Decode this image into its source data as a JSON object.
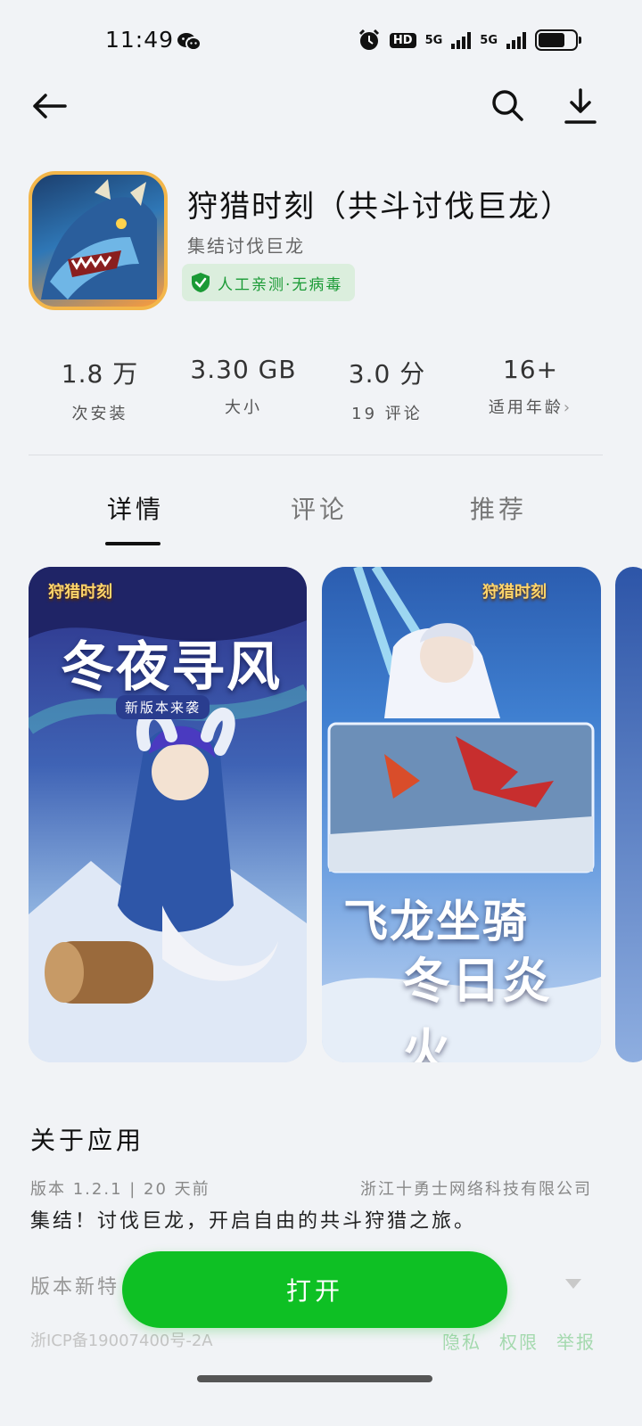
{
  "status": {
    "time": "11:49",
    "hd": "HD",
    "net1": "5G",
    "net2": "5G",
    "battery_level": 0.72
  },
  "nav": {
    "back": "back-arrow-icon",
    "search": "search-icon",
    "download": "download-icon"
  },
  "app": {
    "title": "狩猎时刻（共斗讨伐巨龙）",
    "subtitle": "集结讨伐巨龙",
    "badge": "人工亲测·无病毒"
  },
  "stats": [
    {
      "value": "1.8 万",
      "label": "次安装"
    },
    {
      "value": "3.30 GB",
      "label": "大小"
    },
    {
      "value": "3.0 分",
      "label": "19 评论"
    },
    {
      "value": "16+",
      "label": "适用年龄"
    }
  ],
  "tabs": [
    "详情",
    "评论",
    "推荐"
  ],
  "screenshots": {
    "s1_logo": "狩猎时刻",
    "s1_headline": "冬夜寻风",
    "s1_sub": "新版本来袭",
    "s2_logo": "狩猎时刻",
    "s2_line1": "飞龙坐骑",
    "s2_line2": "冬日炎火"
  },
  "about": {
    "title": "关于应用",
    "version": "版本 1.2.1 | 20 天前",
    "developer": "浙江十勇士网络科技有限公司",
    "description": "集结！讨伐巨龙，开启自由的共斗狩猎之旅。",
    "whats_new": "版本新特"
  },
  "footer": {
    "icp": "浙ICP备19007400号-2A",
    "privacy": "隐私",
    "permissions": "权限",
    "report": "举报"
  },
  "open_button": "打开",
  "colors": {
    "accent_green": "#0ec024",
    "badge_green": "#1a9a35",
    "background": "#f1f3f6"
  }
}
